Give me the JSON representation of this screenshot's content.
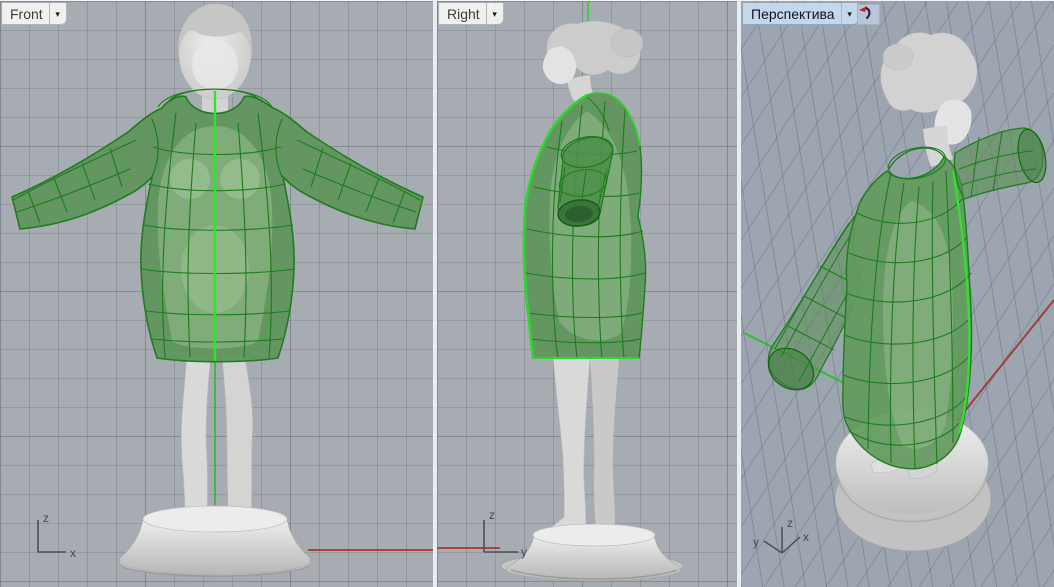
{
  "icons": {
    "dropdown_arrow": "▾",
    "rotate_view_icon": "curved-arrow-with-red-tip"
  },
  "viewports": {
    "front": {
      "label": "Front",
      "axis_vertical": "z",
      "axis_horizontal": "x"
    },
    "right": {
      "label": "Right",
      "axis_vertical": "z",
      "axis_horizontal": "y"
    },
    "perspective": {
      "label": "Перспектива",
      "axis_vertical": "z",
      "axis_right": "x",
      "axis_left": "y"
    }
  },
  "colors": {
    "viewport_bg": "#a7acb3",
    "perspective_bg": "#9da5b1",
    "grid_line": "#8f96a2",
    "label_bg": "#f0f0ee",
    "active_label_bg": "#c4d7eb",
    "garment_fill_green": "#5e9559",
    "garment_wire_green": "#1c7c1c",
    "garment_bright_seam": "#2ee52e",
    "axis_line_red": "#a84438",
    "axis_line_green": "#2ad32a",
    "model_gray": "#d9d9d9"
  },
  "scene": {
    "objects": [
      "female-figure-scan",
      "round-pedestal-base",
      "selected-dress-mesh"
    ]
  }
}
